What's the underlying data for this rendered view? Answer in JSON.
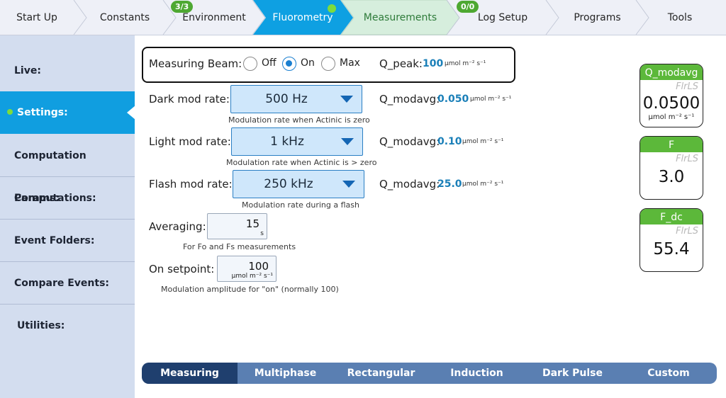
{
  "nav": {
    "items": [
      {
        "label": "Start Up"
      },
      {
        "label": "Constants"
      },
      {
        "label": "Environment",
        "badge": "3/3"
      },
      {
        "label": "Fluorometry"
      },
      {
        "label": "Measurements"
      },
      {
        "label": "Log Setup",
        "badge": "0/0"
      },
      {
        "label": "Programs"
      },
      {
        "label": "Tools"
      }
    ],
    "active_index": 3,
    "colors": {
      "active": "#0ea0e2",
      "visited": "#d6eedd",
      "badge": "#4ea832"
    }
  },
  "sidebar": {
    "items": [
      {
        "label": "Live:"
      },
      {
        "label": "Settings:",
        "active": true
      },
      {
        "label": "Computation Params:"
      },
      {
        "label": "Computations:"
      },
      {
        "label": "Event Folders:"
      },
      {
        "label": "Compare Events:"
      },
      {
        "label": "Utilities:"
      }
    ]
  },
  "beam": {
    "label": "Measuring Beam:",
    "options": [
      "Off",
      "On",
      "Max"
    ],
    "selected": "On",
    "qpeak_label": "Q_peak:",
    "qpeak_value": "100",
    "qpeak_unit": "µmol m⁻² s⁻¹"
  },
  "rates": [
    {
      "label": "Dark mod rate:",
      "value": "500 Hz",
      "hint": "Modulation rate when Actinic is zero",
      "q_label": "Q_modavg:",
      "q_value": "0.050",
      "q_unit": "µmol m⁻² s⁻¹"
    },
    {
      "label": "Light mod rate:",
      "value": "1 kHz",
      "hint": "Modulation rate when Actinic is > zero",
      "q_label": "Q_modavg:",
      "q_value": "0.10",
      "q_unit": "µmol m⁻² s⁻¹"
    },
    {
      "label": "Flash mod rate:",
      "value": "250 kHz",
      "hint": "Modulation rate during a flash",
      "q_label": "Q_modavg:",
      "q_value": "25.0",
      "q_unit": "µmol m⁻² s⁻¹"
    }
  ],
  "averaging": {
    "label": "Averaging:",
    "value": "15",
    "unit": "s",
    "hint": "For Fo and Fs measurements"
  },
  "setpoint": {
    "label": "On setpoint:",
    "value": "100",
    "unit": "µmol m⁻² s⁻¹",
    "hint": "Modulation amplitude for \"on\" (normally 100)"
  },
  "cards": [
    {
      "title": "Q_modavg",
      "source": "FlrLS",
      "value": "0.0500",
      "unit": "µmol m⁻² s⁻¹"
    },
    {
      "title": "F",
      "source": "FlrLS",
      "value": "3.0"
    },
    {
      "title": "F_dc",
      "source": "FlrLS",
      "value": "55.4"
    }
  ],
  "tabs": {
    "items": [
      "Measuring",
      "Multiphase",
      "Rectangular",
      "Induction",
      "Dark Pulse",
      "Custom"
    ],
    "active": "Measuring"
  }
}
